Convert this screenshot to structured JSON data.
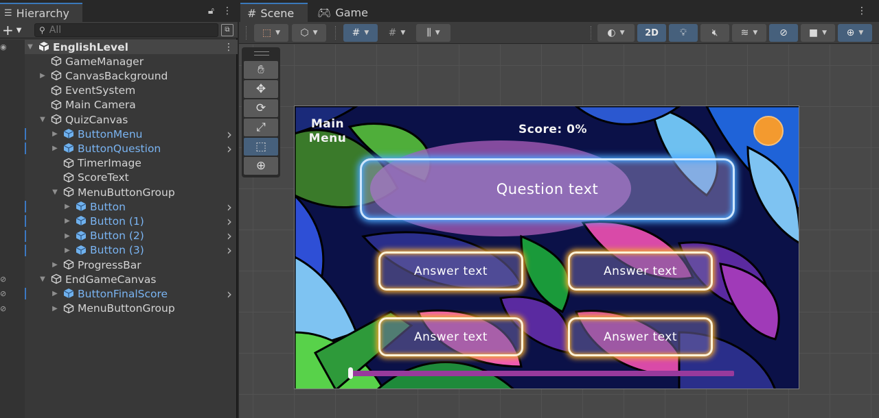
{
  "hierarchy": {
    "tab_label": "Hierarchy",
    "search_placeholder": "All",
    "rows": [
      {
        "name": "EnglishLevel",
        "depth": 0,
        "kind": "scene",
        "expanded": true
      },
      {
        "name": "GameManager",
        "depth": 1,
        "kind": "object"
      },
      {
        "name": "CanvasBackground",
        "depth": 1,
        "kind": "object",
        "collapsed": true
      },
      {
        "name": "EventSystem",
        "depth": 1,
        "kind": "object"
      },
      {
        "name": "Main Camera",
        "depth": 1,
        "kind": "object"
      },
      {
        "name": "QuizCanvas",
        "depth": 1,
        "kind": "object",
        "expanded": true
      },
      {
        "name": "ButtonMenu",
        "depth": 2,
        "kind": "prefab",
        "collapsed": true
      },
      {
        "name": "ButtonQuestion",
        "depth": 2,
        "kind": "prefab",
        "collapsed": true
      },
      {
        "name": "TimerImage",
        "depth": 2,
        "kind": "object"
      },
      {
        "name": "ScoreText",
        "depth": 2,
        "kind": "object"
      },
      {
        "name": "MenuButtonGroup",
        "depth": 2,
        "kind": "object",
        "expanded": true
      },
      {
        "name": "Button",
        "depth": 3,
        "kind": "prefab",
        "collapsed": true
      },
      {
        "name": "Button (1)",
        "depth": 3,
        "kind": "prefab",
        "collapsed": true
      },
      {
        "name": "Button (2)",
        "depth": 3,
        "kind": "prefab",
        "collapsed": true
      },
      {
        "name": "Button (3)",
        "depth": 3,
        "kind": "prefab",
        "collapsed": true
      },
      {
        "name": "ProgressBar",
        "depth": 2,
        "kind": "object",
        "collapsed": true
      },
      {
        "name": "EndGameCanvas",
        "depth": 1,
        "kind": "object",
        "expanded": true,
        "hidden": true
      },
      {
        "name": "ButtonFinalScore",
        "depth": 2,
        "kind": "prefab",
        "collapsed": true,
        "hidden": true
      },
      {
        "name": "MenuButtonGroup",
        "depth": 2,
        "kind": "object",
        "collapsed": true,
        "hidden": true
      }
    ]
  },
  "scene_view": {
    "tabs": [
      {
        "label": "Scene",
        "icon": "hash-icon",
        "active": true
      },
      {
        "label": "Game",
        "icon": "gamepad-icon",
        "active": false
      }
    ],
    "toolbar": {
      "mode_2d_label": "2D"
    },
    "tools": [
      "hand-tool",
      "move-tool",
      "rotate-tool",
      "scale-tool",
      "rect-tool",
      "transform-tool"
    ],
    "selected_tool": "rect-tool"
  },
  "game": {
    "menu_line1": "Main",
    "menu_line2": "Menu",
    "score": "Score: 0%",
    "question": "Question text",
    "answers": [
      "Answer text",
      "Answer text",
      "Answer text",
      "Answer text"
    ],
    "progress": 0,
    "timer_color": "#f39a2f"
  },
  "colors": {
    "accent_blue": "#3a79bb",
    "prefab_text": "#7ab4f2",
    "question_glow": "#4aa8ff",
    "answer_glow": "#f0a830"
  }
}
